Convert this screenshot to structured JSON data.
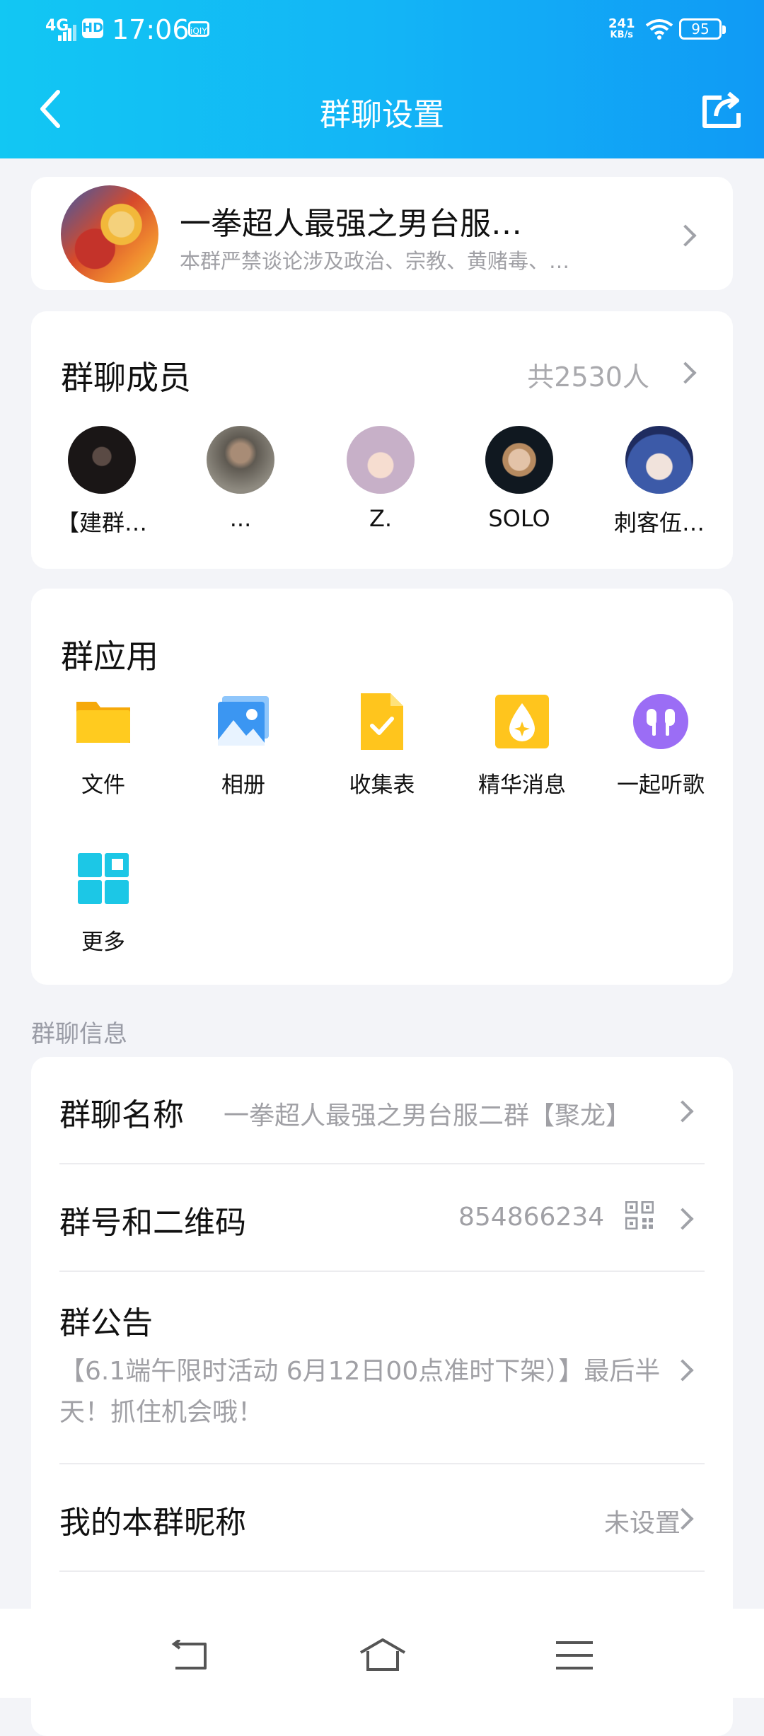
{
  "status_bar": {
    "network": "4G",
    "hd": "HD",
    "time": "17:06",
    "app_badge": "iQIYI",
    "speed_value": "241",
    "speed_unit": "KB/s",
    "battery": "95"
  },
  "nav": {
    "title": "群聊设置"
  },
  "group": {
    "name": "一拳超人最强之男台服…",
    "description": "本群严禁谈论涉及政治、宗教、黄赌毒、…"
  },
  "members": {
    "title": "群聊成员",
    "count": "共2530人",
    "list": [
      {
        "name": "【建群…"
      },
      {
        "name": "..."
      },
      {
        "name": "Z."
      },
      {
        "name": "SOLO"
      },
      {
        "name": "刺客伍…"
      }
    ]
  },
  "apps": {
    "title": "群应用",
    "items": [
      {
        "label": "文件",
        "icon": "folder-icon"
      },
      {
        "label": "相册",
        "icon": "album-icon"
      },
      {
        "label": "收集表",
        "icon": "form-icon"
      },
      {
        "label": "精华消息",
        "icon": "essence-icon"
      },
      {
        "label": "一起听歌",
        "icon": "headphones-icon"
      },
      {
        "label": "更多",
        "icon": "more-grid-icon"
      }
    ]
  },
  "info": {
    "section_label": "群聊信息",
    "name_key": "群聊名称",
    "name_value": "一拳超人最强之男台服二群【聚龙】",
    "id_key": "群号和二维码",
    "id_value": "854866234",
    "notice_key": "群公告",
    "notice_value": "【6.1端午限时活动 6月12日00点准时下架）】最后半天！抓住机会哦！",
    "nickname_key": "我的本群昵称",
    "nickname_value": "未设置"
  },
  "colors": {
    "header_start": "#12c7f3",
    "header_end": "#109af5",
    "background": "#f3f4f8"
  }
}
